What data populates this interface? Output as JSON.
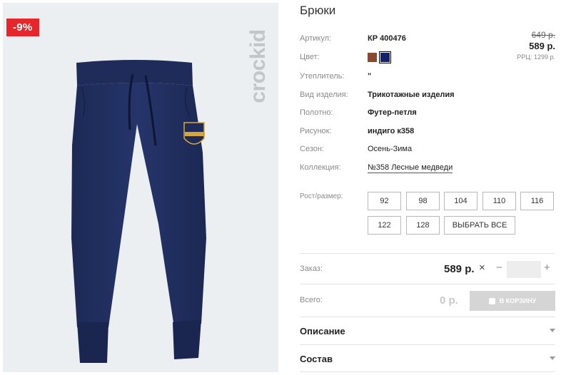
{
  "product": {
    "title": "Брюки",
    "discount_badge": "-9%",
    "brand": "crockid"
  },
  "price": {
    "old": "649 р.",
    "current": "589 р.",
    "rrp": "РРЦ: 1299 р."
  },
  "specs": [
    {
      "label": "Артикул:",
      "value": "КР 400476"
    },
    {
      "label": "Цвет:",
      "value": ""
    },
    {
      "label": "Утеплитель:",
      "value": "\""
    },
    {
      "label": "Вид изделия:",
      "value": "Трикотажные изделия"
    },
    {
      "label": "Полотно:",
      "value": "Футер-петля"
    },
    {
      "label": "Рисунок:",
      "value": "индиго к358"
    },
    {
      "label": "Сезон:",
      "value": "Осень-Зима"
    },
    {
      "label": "Коллекция:",
      "value": "№358 Лесные медведи"
    }
  ],
  "colors": [
    {
      "name": "brown",
      "hex": "#8b4a2f"
    },
    {
      "name": "navy",
      "hex": "#16206b",
      "selected": true
    }
  ],
  "sizes": {
    "label": "Рост/размер:",
    "options": [
      "92",
      "98",
      "104",
      "110",
      "116",
      "122",
      "128"
    ],
    "select_all": "ВЫБРАТЬ ВСЕ"
  },
  "order": {
    "label": "Заказ:",
    "price": "589 р.",
    "quantity": ""
  },
  "total": {
    "label": "Всего:",
    "value": "0 р.",
    "cart_button": "В КОРЗИНУ"
  },
  "accordions": [
    {
      "title": "Описание"
    },
    {
      "title": "Состав"
    }
  ]
}
